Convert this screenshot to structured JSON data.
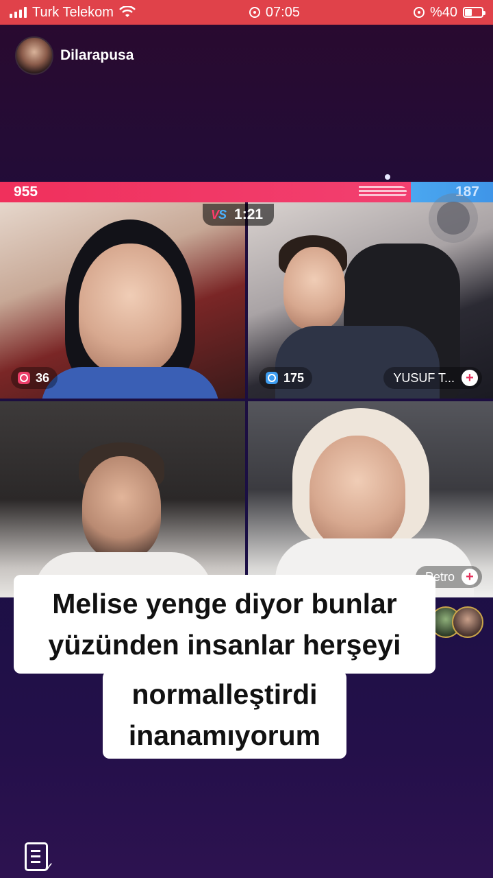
{
  "status_bar": {
    "carrier": "Turk Telekom",
    "time": "07:05",
    "battery": "%40"
  },
  "host": {
    "name": "Dilarapusa"
  },
  "battle": {
    "left_score": "955",
    "right_score": "187",
    "timer": "1:21",
    "left_color": "#f0305c",
    "right_color": "#4aa7f0"
  },
  "tiles": [
    {
      "score": "36",
      "score_color": "#ec3f6a"
    },
    {
      "score": "175",
      "name": "YUSUF T...",
      "score_color": "#3e9df0"
    },
    {
      "score": "",
      "name": ""
    },
    {
      "score": "",
      "name": "Petro"
    }
  ],
  "caption": {
    "line1": "Melise yenge diyor bunlar",
    "line2": "yüzünden insanlar herşeyi",
    "line3": "normalleştirdi",
    "line4": "inanamıyorum"
  }
}
